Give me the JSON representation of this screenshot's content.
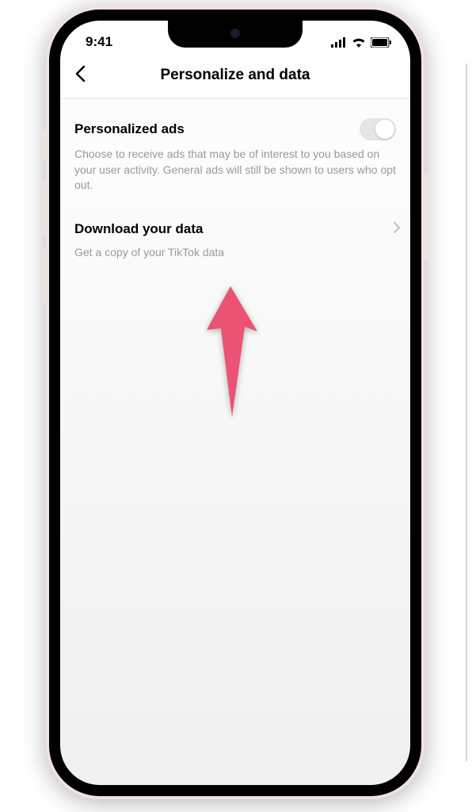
{
  "status_bar": {
    "time": "9:41"
  },
  "header": {
    "title": "Personalize and data"
  },
  "settings": {
    "personalized_ads": {
      "title": "Personalized ads",
      "description": "Choose to receive ads that may be of interest to you based on your user activity. General ads will still be shown to users who opt out."
    },
    "download_data": {
      "title": "Download your data",
      "description": "Get a copy of your TikTok data"
    }
  }
}
